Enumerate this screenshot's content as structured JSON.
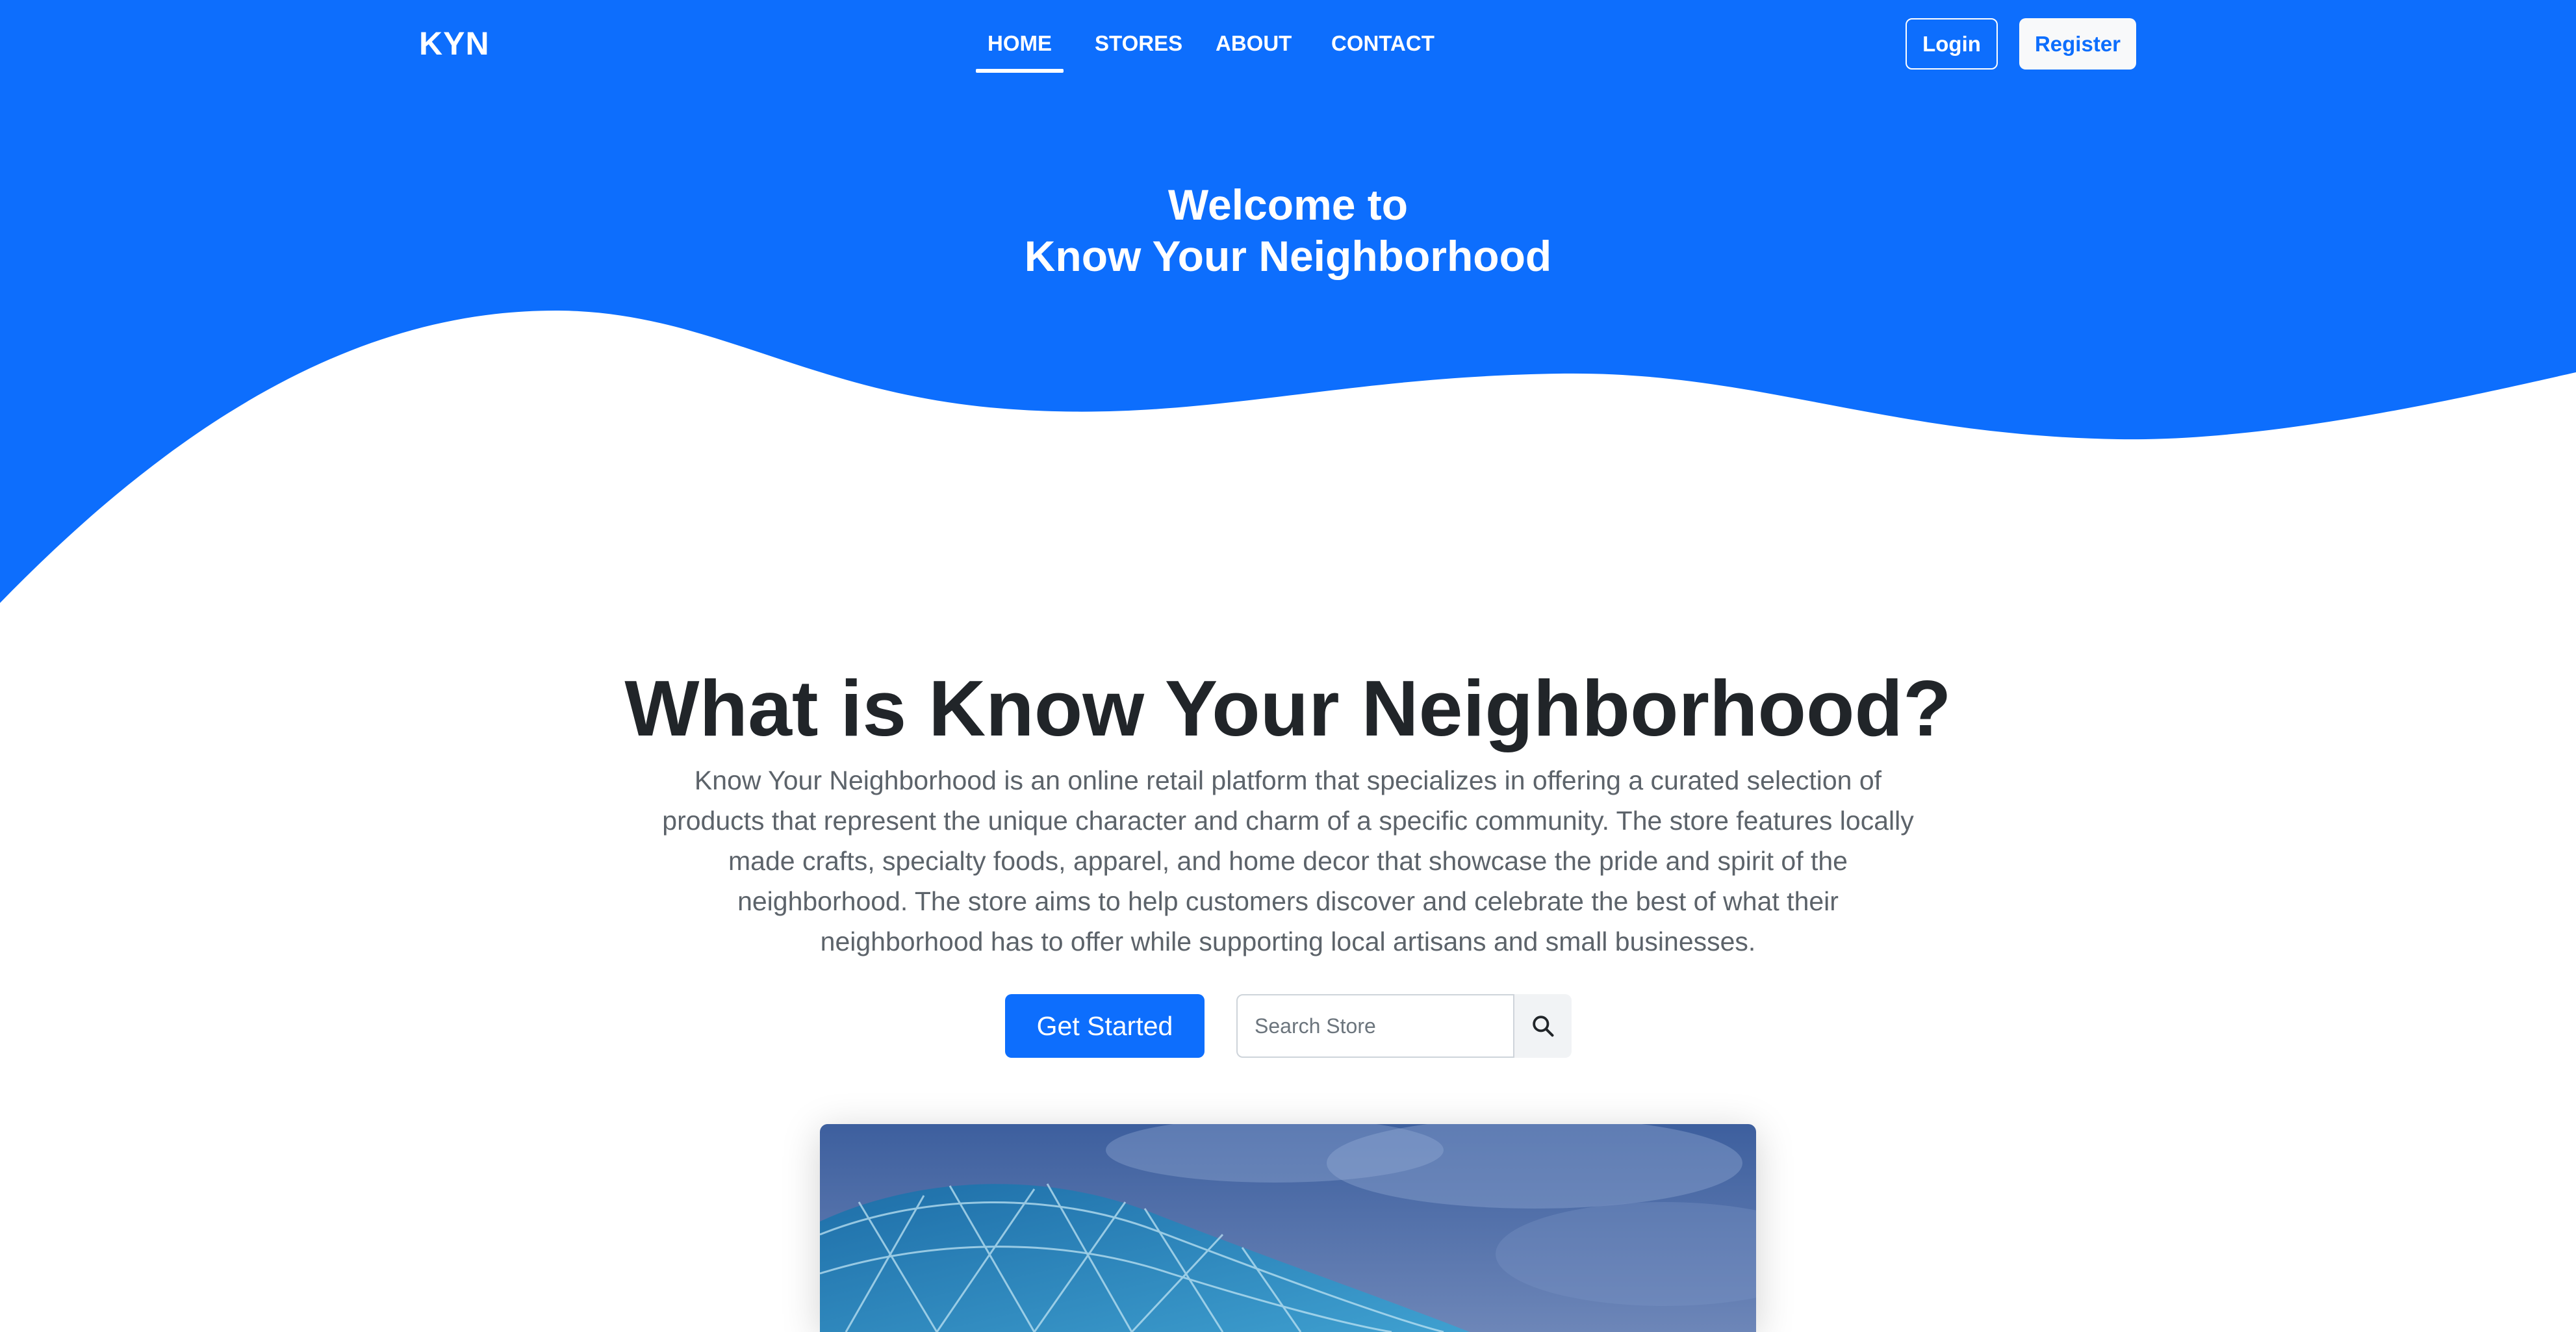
{
  "navbar": {
    "brand": "KYN",
    "links": [
      {
        "label": "HOME",
        "active": true
      },
      {
        "label": "STORES",
        "active": false
      },
      {
        "label": "ABOUT",
        "active": false
      },
      {
        "label": "CONTACT",
        "active": false
      }
    ],
    "login_label": "Login",
    "register_label": "Register"
  },
  "hero": {
    "welcome_line1": "Welcome to",
    "welcome_line2": "Know Your Neighborhood"
  },
  "about": {
    "title": "What is Know Your Neighborhood?",
    "description": "Know Your Neighborhood is an online retail platform that specializes in offering a curated selection of products that represent the unique character and charm of a specific community. The store features locally made crafts, specialty foods, apparel, and home decor that showcase the pride and spirit of the neighborhood. The store aims to help customers discover and celebrate the best of what their neighborhood has to offer while supporting local artisans and small businesses."
  },
  "actions": {
    "get_started_label": "Get Started",
    "search_placeholder": "Search Store",
    "search_value": "",
    "search_icon": "search-icon"
  },
  "colors": {
    "primary": "#0d6efd",
    "white": "#ffffff",
    "heading": "#212529",
    "muted_text": "#5c636a"
  }
}
